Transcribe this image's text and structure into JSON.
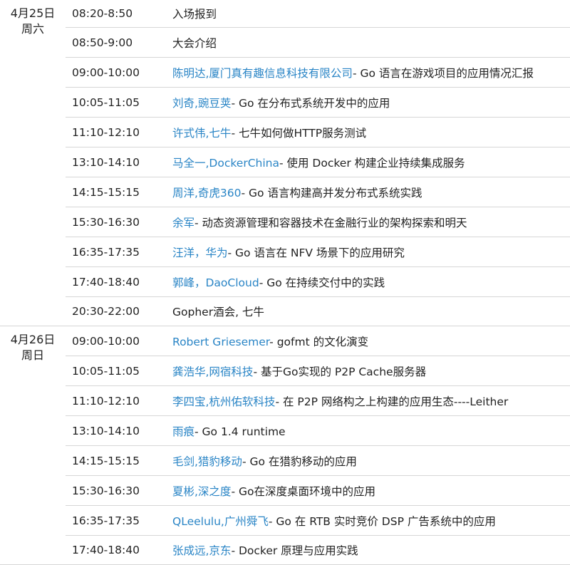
{
  "days": [
    {
      "date": "4月25日",
      "weekday": "周六",
      "sessions": [
        {
          "time": "08:20-8:50",
          "speaker": "",
          "topic": "入场报到"
        },
        {
          "time": "08:50-9:00",
          "speaker": "",
          "topic": "大会介绍"
        },
        {
          "time": "09:00-10:00",
          "speaker": "陈明达,厦门真有趣信息科技有限公司",
          "topic": "- Go 语言在游戏项目的应用情况汇报"
        },
        {
          "time": "10:05-11:05",
          "speaker": "刘奇,豌豆荚",
          "topic": "- Go 在分布式系统开发中的应用"
        },
        {
          "time": "11:10-12:10",
          "speaker": "许式伟,七牛",
          "topic": "- 七牛如何做HTTP服务测试"
        },
        {
          "time": "13:10-14:10",
          "speaker": "马全一,DockerChina",
          "topic": "- 使用 Docker 构建企业持续集成服务"
        },
        {
          "time": "14:15-15:15",
          "speaker": "周洋,奇虎360",
          "topic": "- Go 语言构建高并发分布式系统实践"
        },
        {
          "time": "15:30-16:30",
          "speaker": "余军",
          "topic": "- 动态资源管理和容器技术在金融行业的架构探索和明天"
        },
        {
          "time": "16:35-17:35",
          "speaker": "汪洋，华为",
          "topic": "- Go 语言在 NFV 场景下的应用研究"
        },
        {
          "time": "17:40-18:40",
          "speaker": "郭峰，DaoCloud",
          "topic": "- Go 在持续交付中的实践"
        },
        {
          "time": "20:30-22:00",
          "speaker": "",
          "topic": "Gopher酒会, 七牛"
        }
      ]
    },
    {
      "date": "4月26日",
      "weekday": "周日",
      "sessions": [
        {
          "time": "09:00-10:00",
          "speaker": "Robert Griesemer",
          "topic": "- gofmt 的文化演变"
        },
        {
          "time": "10:05-11:05",
          "speaker": "龚浩华,网宿科技",
          "topic": "- 基于Go实现的 P2P Cache服务器"
        },
        {
          "time": "11:10-12:10",
          "speaker": "李四宝,杭州佑软科技",
          "topic": "- 在 P2P 网络构之上构建的应用生态----Leither"
        },
        {
          "time": "13:10-14:10",
          "speaker": "雨痕",
          "topic": "- Go 1.4 runtime"
        },
        {
          "time": "14:15-15:15",
          "speaker": "毛剑,猎豹移动",
          "topic": "- Go 在猎豹移动的应用"
        },
        {
          "time": "15:30-16:30",
          "speaker": "夏彬,深之度",
          "topic": "- Go在深度桌面环境中的应用"
        },
        {
          "time": "16:35-17:35",
          "speaker": "QLeelulu,广州舜飞",
          "topic": "- Go 在 RTB 实时竞价 DSP 广告系统中的应用"
        },
        {
          "time": "17:40-18:40",
          "speaker": "张成远,京东",
          "topic": "- Docker 原理与应用实践"
        }
      ]
    }
  ]
}
